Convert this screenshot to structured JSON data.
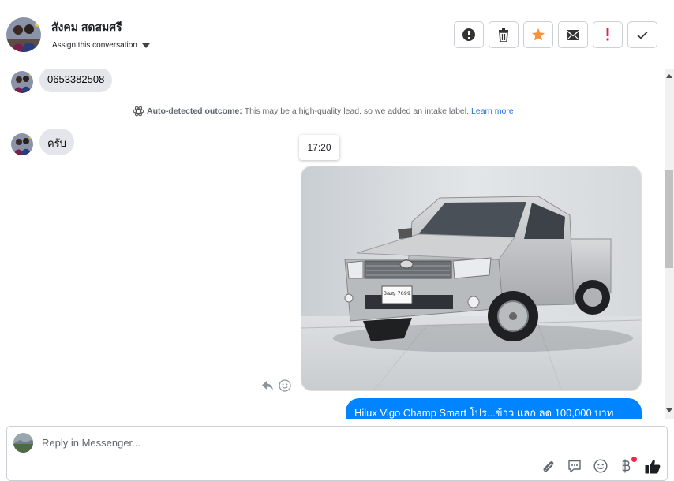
{
  "header": {
    "contact_name": "สังคม สดสมศรี",
    "assign_label": "Assign this conversation",
    "actions": [
      {
        "name": "report-button",
        "icon": "alert-circle-icon"
      },
      {
        "name": "delete-button",
        "icon": "trash-icon"
      },
      {
        "name": "star-button",
        "icon": "star-icon",
        "color": "#f7923b"
      },
      {
        "name": "mark-unread-button",
        "icon": "envelope-icon"
      },
      {
        "name": "flag-button",
        "icon": "exclamation-icon",
        "color": "#e41e3f"
      },
      {
        "name": "done-button",
        "icon": "check-icon"
      }
    ]
  },
  "thread": {
    "messages_in": [
      {
        "text": "0653382508"
      },
      {
        "text": "ครับ"
      }
    ],
    "outcome": {
      "icon": "atom-icon",
      "label": "Auto-detected outcome:",
      "text": "This may be a high-quality lead, so we added an intake label.",
      "link": "Learn more"
    },
    "timestamp": "17:20",
    "photo": {
      "alt": "Silver pickup truck",
      "plate": "3ฒญ 7699"
    },
    "message_out": "Hilux Vigo Champ Smart โปร...ข้าว แลก ลด 100,000 บาท"
  },
  "composer": {
    "placeholder": "Reply in Messenger...",
    "tools": [
      "paperclip-icon",
      "saved-reply-icon",
      "emoji-icon",
      "baht-payment-icon",
      "thumbs-up-icon"
    ]
  },
  "colors": {
    "accent": "#0084ff",
    "incoming_bubble": "#e4e6eb",
    "link": "#216fdb"
  }
}
